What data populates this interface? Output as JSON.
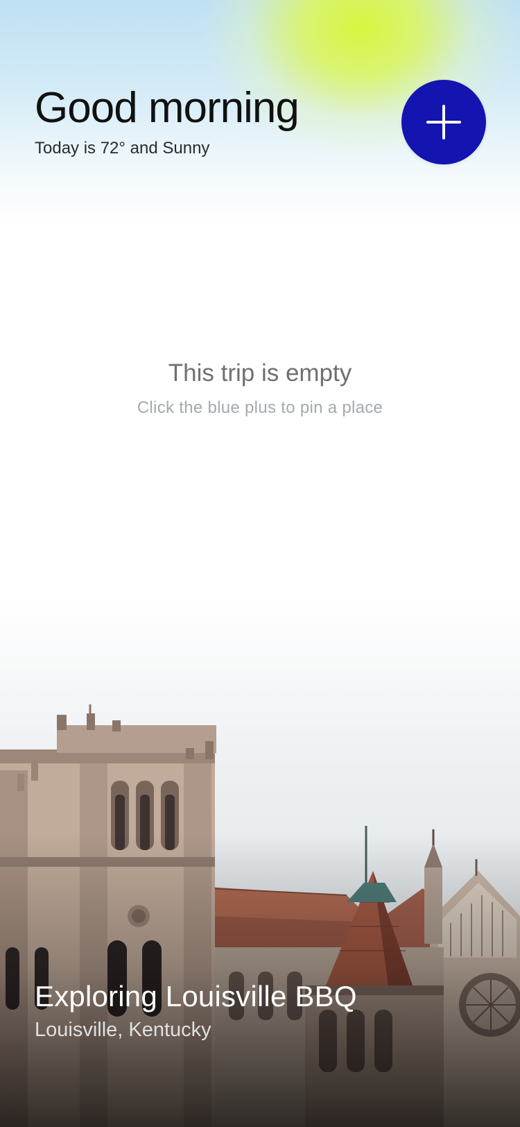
{
  "header": {
    "greeting": "Good morning",
    "weather_text": "Today is 72° and Sunny"
  },
  "add_button": {
    "icon": "plus-icon",
    "color": "#1414b0"
  },
  "empty_state": {
    "title": "This trip is empty",
    "subtitle": "Click the blue plus to pin a place"
  },
  "trip": {
    "title": "Exploring Louisville BBQ",
    "location": "Louisville, Kentucky"
  },
  "colors": {
    "accent": "#1414b0",
    "sun_glow": "#d8f640",
    "sky": "#bfe0f3"
  }
}
